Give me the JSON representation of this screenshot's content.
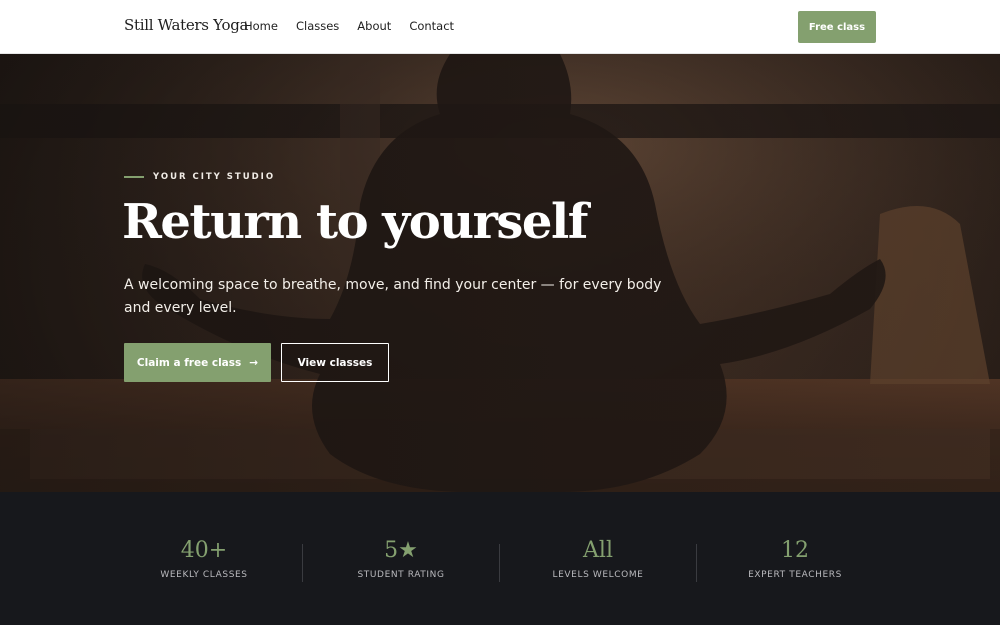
{
  "header": {
    "brand": "Still Waters Yoga",
    "nav": [
      "Home",
      "Classes",
      "About",
      "Contact"
    ],
    "cta_label": "Free class"
  },
  "hero": {
    "eyebrow": "YOUR CITY STUDIO",
    "title": "Return to yourself",
    "subtitle": "A welcoming space to breathe, move, and find your center — for every body and every level.",
    "primary_button": "Claim a free class",
    "primary_arrow": "→",
    "secondary_button": "View classes"
  },
  "stats": [
    {
      "value": "40+",
      "label": "WEEKLY CLASSES"
    },
    {
      "value": "5★",
      "label": "STUDENT RATING"
    },
    {
      "value": "All",
      "label": "LEVELS WELCOME"
    },
    {
      "value": "12",
      "label": "EXPERT TEACHERS"
    }
  ],
  "colors": {
    "accent": "#84a06f",
    "header_bg": "#ffffff",
    "stats_bg": "#17181c"
  }
}
